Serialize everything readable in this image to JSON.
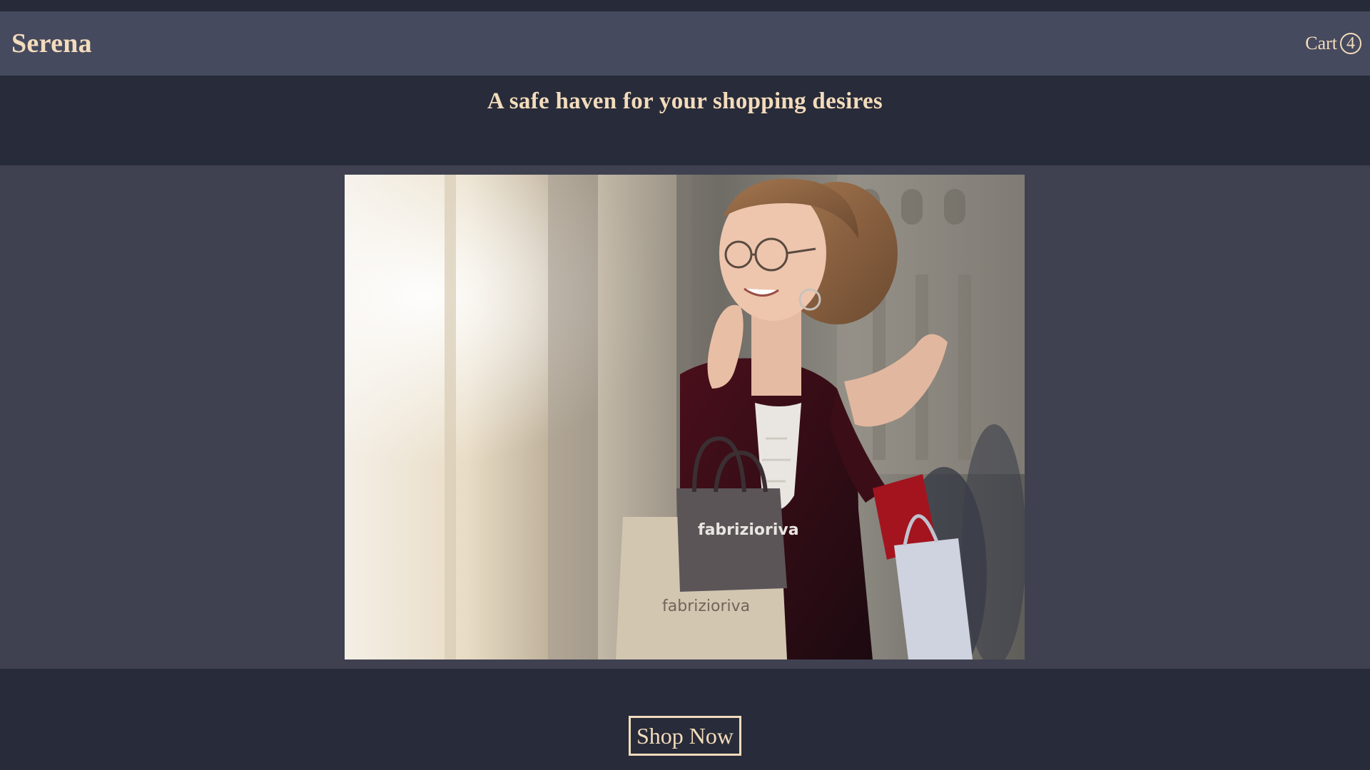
{
  "header": {
    "brand": "Serena",
    "cart_label": "Cart",
    "cart_count": "4"
  },
  "hero": {
    "tagline": "A safe haven for your shopping desires",
    "image_subject": "woman-with-shopping-bags-photo",
    "bag_brand_text": "fabrizioriva"
  },
  "cta": {
    "button_label": "Shop Now"
  },
  "colors": {
    "accent": "#f3dcbc",
    "navbar_bg": "#464a5e",
    "page_bg": "#282b39",
    "hero_bg": "#3f4151"
  }
}
